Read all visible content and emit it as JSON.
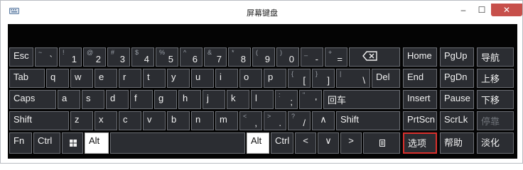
{
  "window": {
    "title": "屏幕键盘"
  },
  "controls": {
    "minimize": "–",
    "maximize": "☐",
    "close": "✕"
  },
  "icons": {
    "app": "keyboard-icon",
    "windows": "windows-logo-icon",
    "backspace": "backspace-icon",
    "menu": "context-menu-icon"
  },
  "keys": {
    "esc": "Esc",
    "tilde": {
      "top": "~",
      "bot": "`"
    },
    "n1": {
      "top": "!",
      "bot": "1"
    },
    "n2": {
      "top": "@",
      "bot": "2"
    },
    "n3": {
      "top": "#",
      "bot": "3"
    },
    "n4": {
      "top": "$",
      "bot": "4"
    },
    "n5": {
      "top": "%",
      "bot": "5"
    },
    "n6": {
      "top": "^",
      "bot": "6"
    },
    "n7": {
      "top": "&",
      "bot": "7"
    },
    "n8": {
      "top": "*",
      "bot": "8"
    },
    "n9": {
      "top": "(",
      "bot": "9"
    },
    "n0": {
      "top": ")",
      "bot": "0"
    },
    "minus": {
      "top": "_",
      "bot": "-"
    },
    "equals": {
      "top": "+",
      "bot": "="
    },
    "home": "Home",
    "pgup": "PgUp",
    "nav": "导航",
    "tab": "Tab",
    "q": "q",
    "w": "w",
    "e": "e",
    "r": "r",
    "t": "t",
    "y": "y",
    "u": "u",
    "i": "i",
    "o": "o",
    "p": "p",
    "lbracket": {
      "top": "{",
      "bot": "["
    },
    "rbracket": {
      "top": "}",
      "bot": "]"
    },
    "backslash": {
      "top": "|",
      "bot": "\\"
    },
    "del": "Del",
    "end": "End",
    "pgdn": "PgDn",
    "moveup": "上移",
    "caps": "Caps",
    "a": "a",
    "s": "s",
    "d": "d",
    "f": "f",
    "g": "g",
    "h": "h",
    "j": "j",
    "k": "k",
    "l": "l",
    "semicolon": {
      "top": ":",
      "bot": ";"
    },
    "quote": {
      "top": "\"",
      "bot": "'"
    },
    "enter": "回车",
    "insert": "Insert",
    "pause": "Pause",
    "movedown": "下移",
    "shift": "Shift",
    "z": "z",
    "x": "x",
    "c": "c",
    "v": "v",
    "b": "b",
    "n": "n",
    "m": "m",
    "comma": {
      "top": "<",
      "bot": ","
    },
    "period": {
      "top": ">",
      "bot": "."
    },
    "slash": {
      "top": "?",
      "bot": "/"
    },
    "up": "∧",
    "shift_r": "Shift",
    "prtscn": "PrtScn",
    "scrlk": "ScrLk",
    "dock": "停靠",
    "fn": "Fn",
    "ctrl": "Ctrl",
    "alt": "Alt",
    "alt_r": "Alt",
    "ctrl_r": "Ctrl",
    "left": "<",
    "down": "∨",
    "right": ">",
    "options": "选项",
    "help": "帮助",
    "fade": "淡化"
  }
}
